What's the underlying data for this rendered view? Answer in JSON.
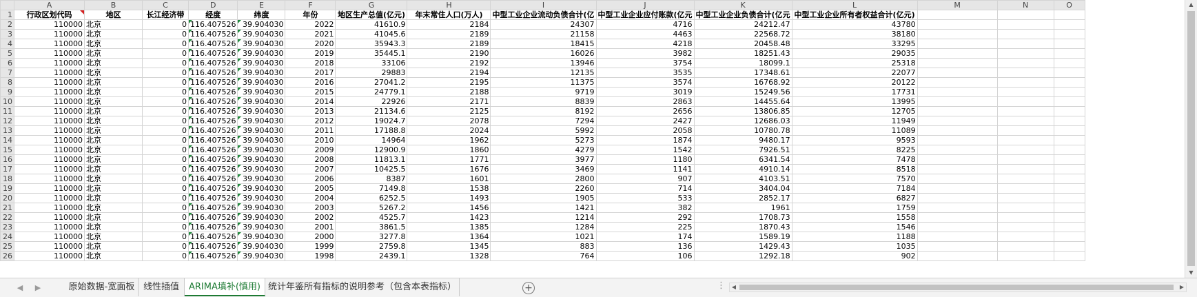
{
  "col_letters": [
    "A",
    "B",
    "C",
    "D",
    "E",
    "F",
    "G",
    "H",
    "I",
    "J",
    "K",
    "L",
    "M",
    "N",
    "O"
  ],
  "headers": [
    "行政区划代码",
    "地区",
    "长江经济带",
    "经度",
    "纬度",
    "年份",
    "地区生产总值(亿元)",
    "年末常住人口(万人)",
    "中型工业企业流动负债合计(亿",
    "中型工业企业应付账款(亿元",
    "中型工业企业负债合计(亿元",
    "中型工业企业所有者权益合计(亿元)",
    "",
    "",
    ""
  ],
  "rows": [
    [
      "110000",
      "北京",
      "0",
      "116.407526",
      "39.904030",
      "2022",
      "41610.9",
      "2184",
      "24307",
      "4716",
      "24212.47",
      "43780"
    ],
    [
      "110000",
      "北京",
      "0",
      "116.407526",
      "39.904030",
      "2021",
      "41045.6",
      "2189",
      "21158",
      "4463",
      "22568.72",
      "38180"
    ],
    [
      "110000",
      "北京",
      "0",
      "116.407526",
      "39.904030",
      "2020",
      "35943.3",
      "2189",
      "18415",
      "4218",
      "20458.48",
      "33295"
    ],
    [
      "110000",
      "北京",
      "0",
      "116.407526",
      "39.904030",
      "2019",
      "35445.1",
      "2190",
      "16026",
      "3982",
      "18251.43",
      "29035"
    ],
    [
      "110000",
      "北京",
      "0",
      "116.407526",
      "39.904030",
      "2018",
      "33106",
      "2192",
      "13946",
      "3754",
      "18099.1",
      "25318"
    ],
    [
      "110000",
      "北京",
      "0",
      "116.407526",
      "39.904030",
      "2017",
      "29883",
      "2194",
      "12135",
      "3535",
      "17348.61",
      "22077"
    ],
    [
      "110000",
      "北京",
      "0",
      "116.407526",
      "39.904030",
      "2016",
      "27041.2",
      "2195",
      "11375",
      "3574",
      "16768.92",
      "20122"
    ],
    [
      "110000",
      "北京",
      "0",
      "116.407526",
      "39.904030",
      "2015",
      "24779.1",
      "2188",
      "9719",
      "3019",
      "15249.56",
      "17731"
    ],
    [
      "110000",
      "北京",
      "0",
      "116.407526",
      "39.904030",
      "2014",
      "22926",
      "2171",
      "8839",
      "2863",
      "14455.64",
      "13995"
    ],
    [
      "110000",
      "北京",
      "0",
      "116.407526",
      "39.904030",
      "2013",
      "21134.6",
      "2125",
      "8192",
      "2656",
      "13806.85",
      "12705"
    ],
    [
      "110000",
      "北京",
      "0",
      "116.407526",
      "39.904030",
      "2012",
      "19024.7",
      "2078",
      "7294",
      "2427",
      "12686.03",
      "11949"
    ],
    [
      "110000",
      "北京",
      "0",
      "116.407526",
      "39.904030",
      "2011",
      "17188.8",
      "2024",
      "5992",
      "2058",
      "10780.78",
      "11089"
    ],
    [
      "110000",
      "北京",
      "0",
      "116.407526",
      "39.904030",
      "2010",
      "14964",
      "1962",
      "5273",
      "1874",
      "9480.17",
      "9593"
    ],
    [
      "110000",
      "北京",
      "0",
      "116.407526",
      "39.904030",
      "2009",
      "12900.9",
      "1860",
      "4279",
      "1542",
      "7926.51",
      "8225"
    ],
    [
      "110000",
      "北京",
      "0",
      "116.407526",
      "39.904030",
      "2008",
      "11813.1",
      "1771",
      "3977",
      "1180",
      "6341.54",
      "7478"
    ],
    [
      "110000",
      "北京",
      "0",
      "116.407526",
      "39.904030",
      "2007",
      "10425.5",
      "1676",
      "3469",
      "1141",
      "4910.14",
      "8518"
    ],
    [
      "110000",
      "北京",
      "0",
      "116.407526",
      "39.904030",
      "2006",
      "8387",
      "1601",
      "2800",
      "907",
      "4103.51",
      "7570"
    ],
    [
      "110000",
      "北京",
      "0",
      "116.407526",
      "39.904030",
      "2005",
      "7149.8",
      "1538",
      "2260",
      "714",
      "3404.04",
      "7184"
    ],
    [
      "110000",
      "北京",
      "0",
      "116.407526",
      "39.904030",
      "2004",
      "6252.5",
      "1493",
      "1905",
      "533",
      "2852.17",
      "6827"
    ],
    [
      "110000",
      "北京",
      "0",
      "116.407526",
      "39.904030",
      "2003",
      "5267.2",
      "1456",
      "1421",
      "382",
      "1961",
      "1759"
    ],
    [
      "110000",
      "北京",
      "0",
      "116.407526",
      "39.904030",
      "2002",
      "4525.7",
      "1423",
      "1214",
      "292",
      "1708.73",
      "1558"
    ],
    [
      "110000",
      "北京",
      "0",
      "116.407526",
      "39.904030",
      "2001",
      "3861.5",
      "1385",
      "1284",
      "225",
      "1870.43",
      "1546"
    ],
    [
      "110000",
      "北京",
      "0",
      "116.407526",
      "39.904030",
      "2000",
      "3277.8",
      "1364",
      "1021",
      "174",
      "1589.19",
      "1188"
    ],
    [
      "110000",
      "北京",
      "0",
      "116.407526",
      "39.904030",
      "1999",
      "2759.8",
      "1345",
      "883",
      "136",
      "1429.43",
      "1035"
    ],
    [
      "110000",
      "北京",
      "0",
      "116.407526",
      "39.904030",
      "1998",
      "2439.1",
      "1328",
      "764",
      "106",
      "1292.18",
      "902"
    ]
  ],
  "tabs": [
    "原始数据-宽面板",
    "线性插值",
    "ARIMA填补(慎用)",
    "统计年鉴所有指标的说明参考（包含本表指标）"
  ],
  "active_tab": 2,
  "add_sheet_label": "+",
  "more_label": "⋮",
  "colors": {
    "accent": "#1e7b34",
    "flag_green": "#1f8a3b",
    "flag_red": "#d42020"
  }
}
